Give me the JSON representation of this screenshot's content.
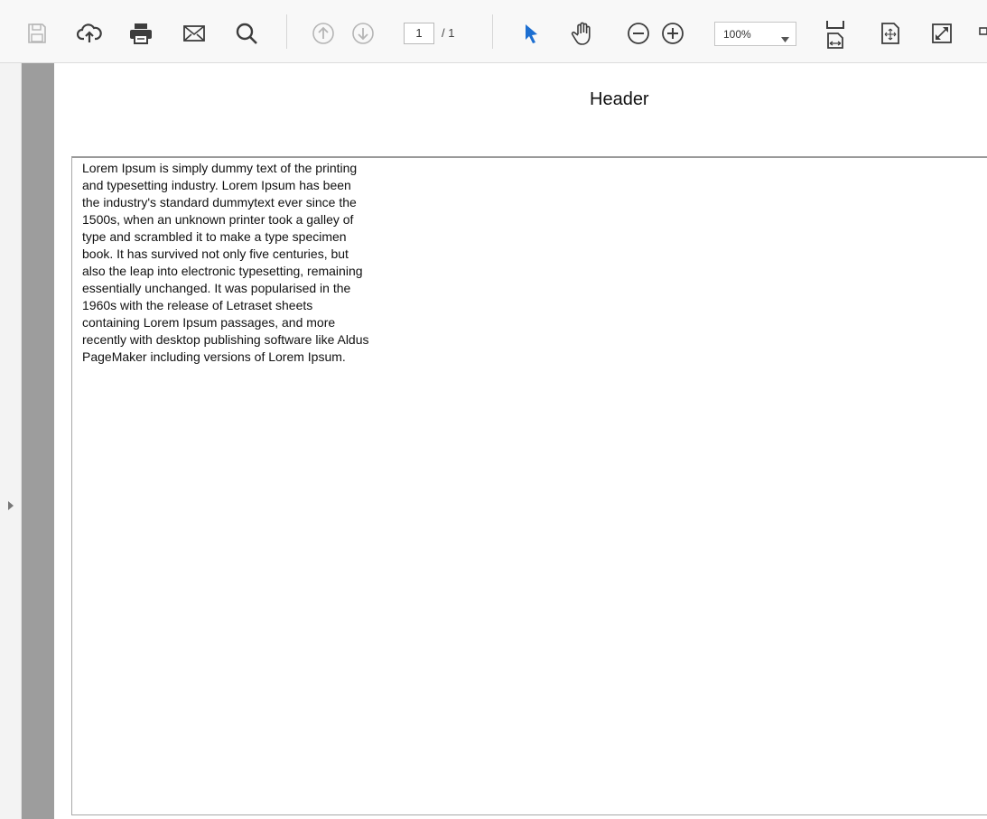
{
  "toolbar": {
    "icons": [
      "save-icon",
      "cloud-upload-icon",
      "print-icon",
      "email-icon",
      "search-icon",
      "previous-page-icon",
      "next-page-icon",
      "select-cursor-icon",
      "hand-tool-icon",
      "zoom-out-icon",
      "zoom-in-icon",
      "fit-width-icon",
      "fit-page-icon",
      "full-screen-icon"
    ],
    "current_page": "1",
    "total_pages": "/ 1",
    "zoom": "100%"
  },
  "colors": {
    "accent": "#1d6fd1",
    "icon": "#3d3d3d",
    "icon_disabled": "#b5b5b5",
    "side_panel": "#9d9d9d"
  },
  "document": {
    "header": "Header",
    "body": "Lorem Ipsum is simply dummy text of the printing and typesetting industry. Lorem Ipsum has been the industry's standard dummytext ever since the 1500s, when an unknown printer took a galley of type and scrambled it to make a type specimen book. It has survived not only five centuries, but also the leap into electronic typesetting, remaining essentially unchanged. It was popularised in the 1960s with the release of Letraset sheets containing Lorem Ipsum passages, and more recently with desktop publishing software like Aldus PageMaker including versions of Lorem Ipsum."
  }
}
